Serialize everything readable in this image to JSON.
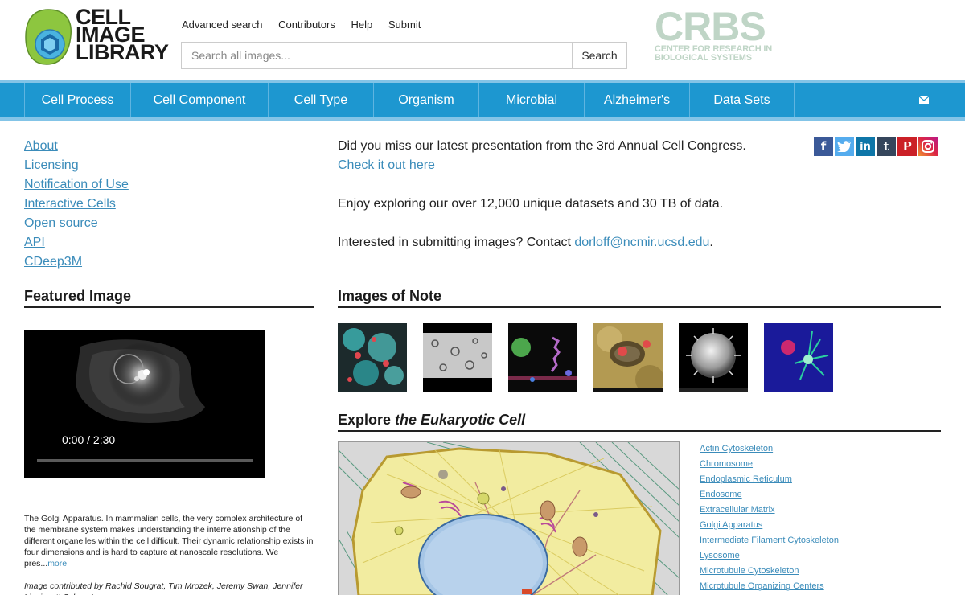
{
  "logo": {
    "lines": [
      "CELL",
      "IMAGE",
      "LIBRARY"
    ]
  },
  "top_links": [
    "Advanced search",
    "Contributors",
    "Help",
    "Submit"
  ],
  "search": {
    "placeholder": "Search all images...",
    "button": "Search"
  },
  "partner": {
    "big": "CRBS",
    "small_line1": "CENTER FOR RESEARCH IN",
    "small_line2": "BIOLOGICAL SYSTEMS"
  },
  "nav": {
    "items": [
      "Cell Process",
      "Cell Component",
      "Cell Type",
      "Organism",
      "Microbial",
      "Alzheimer's",
      "Data Sets"
    ],
    "mail_icon": "envelope-icon"
  },
  "left_links": [
    "About",
    "Licensing",
    "Notification of Use",
    "Interactive Cells",
    "Open source",
    "API",
    "CDeep3M"
  ],
  "featured": {
    "heading": "Featured Image",
    "video_time": "0:00 / 2:30",
    "description": "The Golgi Apparatus. In mammalian cells, the very complex architecture of the membrane system makes understanding the interrelationship of the different organelles within the cell difficult. Their dynamic relationship exists in four dimensions and is hard to capture at nanoscale resolutions. We pres...",
    "more": "more",
    "credit": "Image contributed by Rachid Sougrat, Tim Mrozek, Jeremy Swan, Jennifer Lippincott-Schwartz"
  },
  "intro": {
    "line1": "Did you miss our latest presentation from the 3rd Annual Cell Congress.",
    "line1_link": "Check it out here",
    "line2": "Enjoy exploring our over 12,000 unique datasets and 30 TB of data.",
    "line3": "Interested in submitting images? Contact ",
    "line3_link": "dorloff@ncmir.ucsd.edu",
    "line3_end": "."
  },
  "social": [
    {
      "icon": "facebook-icon",
      "glyph": "f",
      "color": "#3b5998"
    },
    {
      "icon": "twitter-icon",
      "glyph": "t",
      "color": "#55acee"
    },
    {
      "icon": "linkedin-icon",
      "glyph": "in",
      "color": "#0e76a8"
    },
    {
      "icon": "tumblr-icon",
      "glyph": "t",
      "color": "#35465c"
    },
    {
      "icon": "pinterest-icon",
      "glyph": "P",
      "color": "#cb2027"
    },
    {
      "icon": "instagram-icon",
      "glyph": "◎",
      "color": "#d6249f"
    }
  ],
  "images_of_note": {
    "heading": "Images of Note"
  },
  "explore": {
    "heading_plain": "Explore ",
    "heading_em": "the Eukaryotic Cell",
    "links": [
      "Actin Cytoskeleton",
      "Chromosome",
      "Endoplasmic Reticulum",
      "Endosome",
      "Extracellular Matrix",
      "Golgi Apparatus",
      "Intermediate Filament Cytoskeleton",
      "Lysosome",
      "Microtubule Cytoskeleton",
      "Microtubule Organizing Centers"
    ]
  },
  "colors": {
    "nav_bg": "#1d97d0",
    "nav_accent": "#83c4e7",
    "link": "#3b8cba",
    "logo_green": "#8dc63f",
    "partner_green": "#bfd5c6"
  }
}
